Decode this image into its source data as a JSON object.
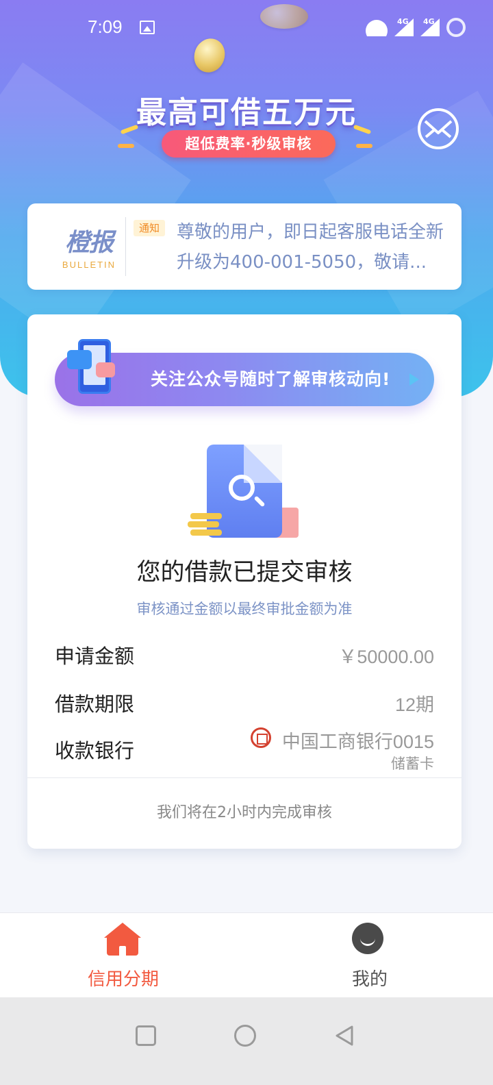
{
  "status_bar": {
    "time": "7:09",
    "network_1": "4G",
    "network_2": "4G"
  },
  "banner": {
    "title": "最高可借五万元",
    "subtitle": "超低费率·秒级审核"
  },
  "bulletin": {
    "logo_zh": "橙报",
    "logo_en": "BULLETIN",
    "tag": "通知",
    "text": "尊敬的用户，即日起客服电话全新升级为400-001-5050，敬请..."
  },
  "follow_banner": {
    "text": "关注公众号随时了解审核动向!"
  },
  "review": {
    "title": "您的借款已提交审核",
    "subtitle": "审核通过金额以最终审批金额为准",
    "rows": [
      {
        "label": "申请金额",
        "value": "￥50000.00"
      },
      {
        "label": "借款期限",
        "value": "12期"
      },
      {
        "label": "收款银行",
        "value": "中国工商银行0015",
        "subvalue": "储蓄卡"
      }
    ],
    "footer": "我们将在2小时内完成审核"
  },
  "tabs": [
    {
      "label": "信用分期",
      "icon": "home-icon",
      "active": true,
      "color": "#f25a40"
    },
    {
      "label": "我的",
      "icon": "user-icon",
      "active": false,
      "color": "#555555"
    }
  ],
  "colors": {
    "accent": "#f25a40",
    "link_blue": "#7c93c6"
  }
}
